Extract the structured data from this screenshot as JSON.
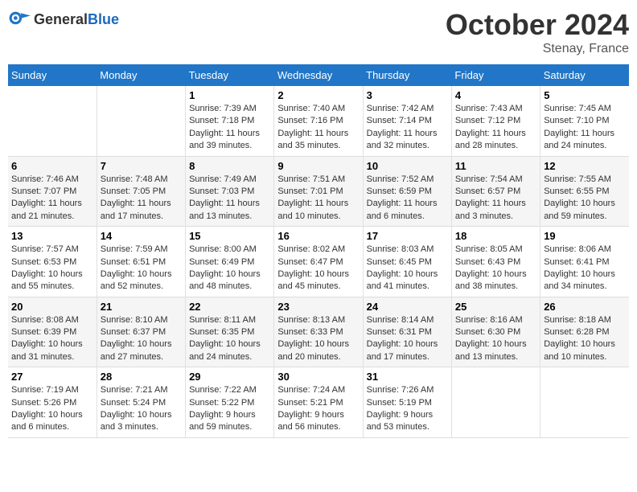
{
  "header": {
    "logo_general": "General",
    "logo_blue": "Blue",
    "month_title": "October 2024",
    "location": "Stenay, France"
  },
  "days_of_week": [
    "Sunday",
    "Monday",
    "Tuesday",
    "Wednesday",
    "Thursday",
    "Friday",
    "Saturday"
  ],
  "weeks": [
    [
      {
        "day": "",
        "sunrise": "",
        "sunset": "",
        "daylight": ""
      },
      {
        "day": "",
        "sunrise": "",
        "sunset": "",
        "daylight": ""
      },
      {
        "day": "1",
        "sunrise": "Sunrise: 7:39 AM",
        "sunset": "Sunset: 7:18 PM",
        "daylight": "Daylight: 11 hours and 39 minutes."
      },
      {
        "day": "2",
        "sunrise": "Sunrise: 7:40 AM",
        "sunset": "Sunset: 7:16 PM",
        "daylight": "Daylight: 11 hours and 35 minutes."
      },
      {
        "day": "3",
        "sunrise": "Sunrise: 7:42 AM",
        "sunset": "Sunset: 7:14 PM",
        "daylight": "Daylight: 11 hours and 32 minutes."
      },
      {
        "day": "4",
        "sunrise": "Sunrise: 7:43 AM",
        "sunset": "Sunset: 7:12 PM",
        "daylight": "Daylight: 11 hours and 28 minutes."
      },
      {
        "day": "5",
        "sunrise": "Sunrise: 7:45 AM",
        "sunset": "Sunset: 7:10 PM",
        "daylight": "Daylight: 11 hours and 24 minutes."
      }
    ],
    [
      {
        "day": "6",
        "sunrise": "Sunrise: 7:46 AM",
        "sunset": "Sunset: 7:07 PM",
        "daylight": "Daylight: 11 hours and 21 minutes."
      },
      {
        "day": "7",
        "sunrise": "Sunrise: 7:48 AM",
        "sunset": "Sunset: 7:05 PM",
        "daylight": "Daylight: 11 hours and 17 minutes."
      },
      {
        "day": "8",
        "sunrise": "Sunrise: 7:49 AM",
        "sunset": "Sunset: 7:03 PM",
        "daylight": "Daylight: 11 hours and 13 minutes."
      },
      {
        "day": "9",
        "sunrise": "Sunrise: 7:51 AM",
        "sunset": "Sunset: 7:01 PM",
        "daylight": "Daylight: 11 hours and 10 minutes."
      },
      {
        "day": "10",
        "sunrise": "Sunrise: 7:52 AM",
        "sunset": "Sunset: 6:59 PM",
        "daylight": "Daylight: 11 hours and 6 minutes."
      },
      {
        "day": "11",
        "sunrise": "Sunrise: 7:54 AM",
        "sunset": "Sunset: 6:57 PM",
        "daylight": "Daylight: 11 hours and 3 minutes."
      },
      {
        "day": "12",
        "sunrise": "Sunrise: 7:55 AM",
        "sunset": "Sunset: 6:55 PM",
        "daylight": "Daylight: 10 hours and 59 minutes."
      }
    ],
    [
      {
        "day": "13",
        "sunrise": "Sunrise: 7:57 AM",
        "sunset": "Sunset: 6:53 PM",
        "daylight": "Daylight: 10 hours and 55 minutes."
      },
      {
        "day": "14",
        "sunrise": "Sunrise: 7:59 AM",
        "sunset": "Sunset: 6:51 PM",
        "daylight": "Daylight: 10 hours and 52 minutes."
      },
      {
        "day": "15",
        "sunrise": "Sunrise: 8:00 AM",
        "sunset": "Sunset: 6:49 PM",
        "daylight": "Daylight: 10 hours and 48 minutes."
      },
      {
        "day": "16",
        "sunrise": "Sunrise: 8:02 AM",
        "sunset": "Sunset: 6:47 PM",
        "daylight": "Daylight: 10 hours and 45 minutes."
      },
      {
        "day": "17",
        "sunrise": "Sunrise: 8:03 AM",
        "sunset": "Sunset: 6:45 PM",
        "daylight": "Daylight: 10 hours and 41 minutes."
      },
      {
        "day": "18",
        "sunrise": "Sunrise: 8:05 AM",
        "sunset": "Sunset: 6:43 PM",
        "daylight": "Daylight: 10 hours and 38 minutes."
      },
      {
        "day": "19",
        "sunrise": "Sunrise: 8:06 AM",
        "sunset": "Sunset: 6:41 PM",
        "daylight": "Daylight: 10 hours and 34 minutes."
      }
    ],
    [
      {
        "day": "20",
        "sunrise": "Sunrise: 8:08 AM",
        "sunset": "Sunset: 6:39 PM",
        "daylight": "Daylight: 10 hours and 31 minutes."
      },
      {
        "day": "21",
        "sunrise": "Sunrise: 8:10 AM",
        "sunset": "Sunset: 6:37 PM",
        "daylight": "Daylight: 10 hours and 27 minutes."
      },
      {
        "day": "22",
        "sunrise": "Sunrise: 8:11 AM",
        "sunset": "Sunset: 6:35 PM",
        "daylight": "Daylight: 10 hours and 24 minutes."
      },
      {
        "day": "23",
        "sunrise": "Sunrise: 8:13 AM",
        "sunset": "Sunset: 6:33 PM",
        "daylight": "Daylight: 10 hours and 20 minutes."
      },
      {
        "day": "24",
        "sunrise": "Sunrise: 8:14 AM",
        "sunset": "Sunset: 6:31 PM",
        "daylight": "Daylight: 10 hours and 17 minutes."
      },
      {
        "day": "25",
        "sunrise": "Sunrise: 8:16 AM",
        "sunset": "Sunset: 6:30 PM",
        "daylight": "Daylight: 10 hours and 13 minutes."
      },
      {
        "day": "26",
        "sunrise": "Sunrise: 8:18 AM",
        "sunset": "Sunset: 6:28 PM",
        "daylight": "Daylight: 10 hours and 10 minutes."
      }
    ],
    [
      {
        "day": "27",
        "sunrise": "Sunrise: 7:19 AM",
        "sunset": "Sunset: 5:26 PM",
        "daylight": "Daylight: 10 hours and 6 minutes."
      },
      {
        "day": "28",
        "sunrise": "Sunrise: 7:21 AM",
        "sunset": "Sunset: 5:24 PM",
        "daylight": "Daylight: 10 hours and 3 minutes."
      },
      {
        "day": "29",
        "sunrise": "Sunrise: 7:22 AM",
        "sunset": "Sunset: 5:22 PM",
        "daylight": "Daylight: 9 hours and 59 minutes."
      },
      {
        "day": "30",
        "sunrise": "Sunrise: 7:24 AM",
        "sunset": "Sunset: 5:21 PM",
        "daylight": "Daylight: 9 hours and 56 minutes."
      },
      {
        "day": "31",
        "sunrise": "Sunrise: 7:26 AM",
        "sunset": "Sunset: 5:19 PM",
        "daylight": "Daylight: 9 hours and 53 minutes."
      },
      {
        "day": "",
        "sunrise": "",
        "sunset": "",
        "daylight": ""
      },
      {
        "day": "",
        "sunrise": "",
        "sunset": "",
        "daylight": ""
      }
    ]
  ]
}
